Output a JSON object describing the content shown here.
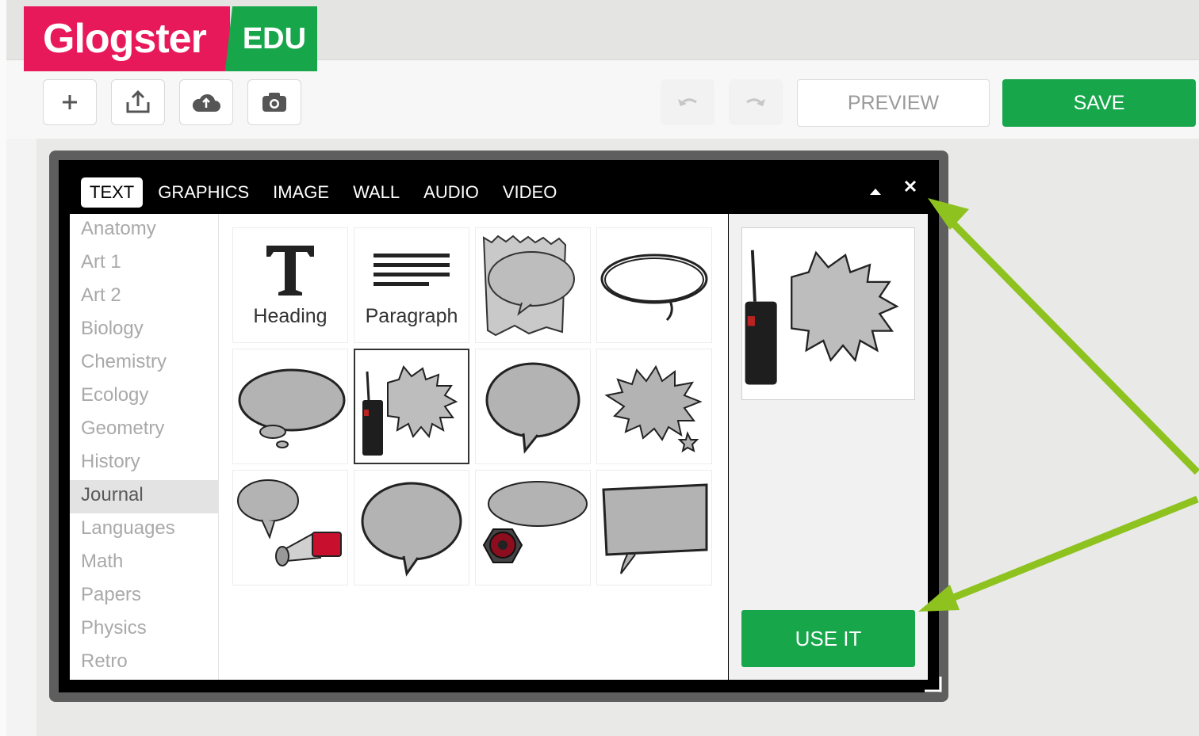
{
  "logo": {
    "main": "Glogster",
    "badge": "EDU"
  },
  "toolbar": {
    "add_icon": "plus-icon",
    "upload_icon": "upload-icon",
    "cloud_icon": "cloud-upload-icon",
    "camera_icon": "camera-icon",
    "undo_icon": "undo-icon",
    "redo_icon": "redo-icon",
    "preview_label": "PREVIEW",
    "save_label": "SAVE"
  },
  "panel": {
    "tabs": [
      {
        "label": "TEXT",
        "active": true
      },
      {
        "label": "GRAPHICS",
        "active": false
      },
      {
        "label": "IMAGE",
        "active": false
      },
      {
        "label": "WALL",
        "active": false
      },
      {
        "label": "AUDIO",
        "active": false
      },
      {
        "label": "VIDEO",
        "active": false
      }
    ],
    "collapse_icon": "caret-up-icon",
    "close_icon": "close-icon",
    "categories": [
      "Anatomy",
      "Art 1",
      "Art 2",
      "Biology",
      "Chemistry",
      "Ecology",
      "Geometry",
      "History",
      "Journal",
      "Languages",
      "Math",
      "Papers",
      "Physics",
      "Retro"
    ],
    "selected_category": "Journal",
    "items": [
      {
        "label": "Heading",
        "icon": "heading-t-icon"
      },
      {
        "label": "Paragraph",
        "icon": "paragraph-lines-icon"
      },
      {
        "label": "",
        "icon": "torn-paper-speech-bubble"
      },
      {
        "label": "",
        "icon": "scribble-speech-bubble"
      },
      {
        "label": "",
        "icon": "thought-bubble"
      },
      {
        "label": "",
        "icon": "walkie-talkie-burst-bubble",
        "selected": true
      },
      {
        "label": "",
        "icon": "oval-speech-bubble"
      },
      {
        "label": "",
        "icon": "spiky-burst-bubble"
      },
      {
        "label": "",
        "icon": "megaphone-bubble"
      },
      {
        "label": "",
        "icon": "round-speech-bubble"
      },
      {
        "label": "",
        "icon": "speaker-bubble"
      },
      {
        "label": "",
        "icon": "rectangle-speech-bubble"
      }
    ],
    "next_icon": "chevron-right-icon",
    "use_it_label": "USE IT"
  },
  "colors": {
    "brand_pink": "#e8195b",
    "brand_green": "#17a64a",
    "arrow_green": "#8dc21f"
  }
}
